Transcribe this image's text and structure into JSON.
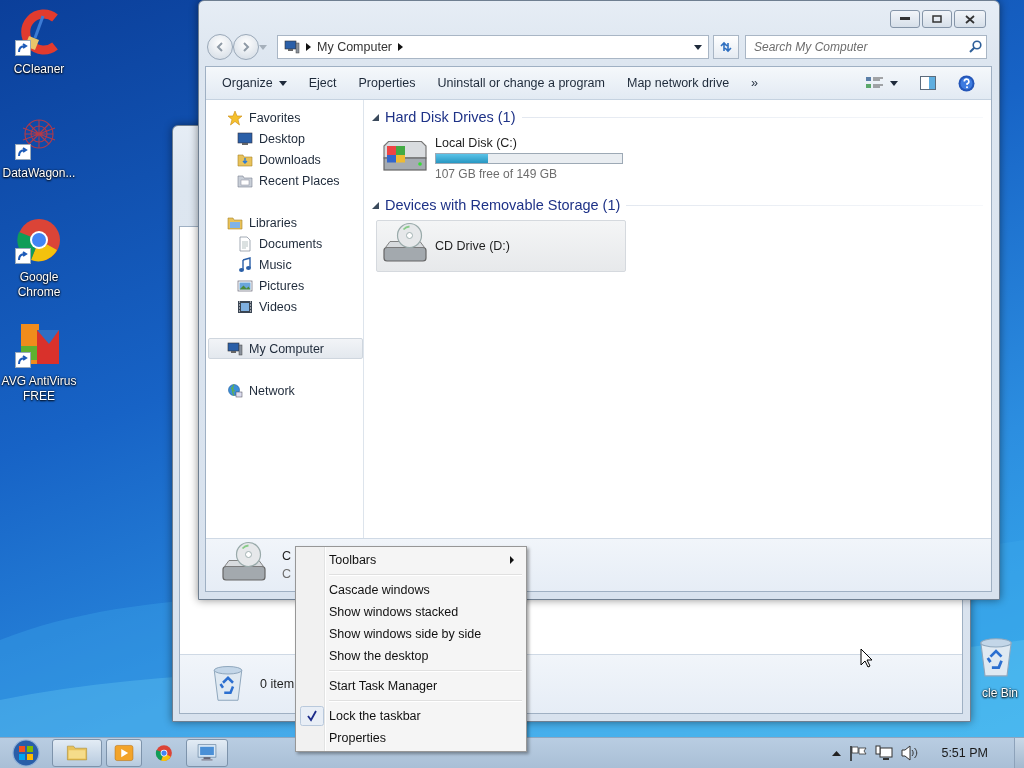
{
  "desktop_icons": [
    {
      "kind": "ccleaner",
      "label": "CCleaner"
    },
    {
      "kind": "datawagon",
      "label": "DataWagon..."
    },
    {
      "kind": "browser",
      "label": "Google Chrome"
    },
    {
      "kind": "antivirus",
      "label": "AVG AntiVirus FREE"
    }
  ],
  "recycle_bin": {
    "label": "cle Bin"
  },
  "back_window": {
    "status": "0 item"
  },
  "explorer": {
    "address": [
      "My Computer"
    ],
    "search": {
      "placeholder": "Search My Computer"
    },
    "commands": [
      {
        "label": "Organize",
        "dropdown": true
      },
      {
        "label": "Eject",
        "dropdown": false
      },
      {
        "label": "Properties",
        "dropdown": false
      },
      {
        "label": "Uninstall or change a program",
        "dropdown": false
      },
      {
        "label": "Map network drive",
        "dropdown": false
      },
      {
        "label": "»",
        "dropdown": false
      }
    ],
    "nav": [
      {
        "kind": "star",
        "label": "Favorites",
        "selected": false,
        "children": [
          {
            "kind": "desktop",
            "label": "Desktop",
            "selected": false
          },
          {
            "kind": "downloads",
            "label": "Downloads",
            "selected": false
          },
          {
            "kind": "recent",
            "label": "Recent Places",
            "selected": false
          }
        ]
      },
      {
        "kind": "library",
        "label": "Libraries",
        "selected": false,
        "children": [
          {
            "kind": "documents",
            "label": "Documents",
            "selected": false
          },
          {
            "kind": "music",
            "label": "Music",
            "selected": false
          },
          {
            "kind": "pictures",
            "label": "Pictures",
            "selected": false
          },
          {
            "kind": "videos",
            "label": "Videos",
            "selected": false
          }
        ]
      },
      {
        "kind": "computer",
        "label": "My Computer",
        "selected": true
      },
      {
        "kind": "network",
        "label": "Network",
        "selected": false
      }
    ],
    "groups": [
      {
        "title": "Hard Disk Drives (1)",
        "expanded": true,
        "drives": [
          {
            "kind": "harddisk",
            "name": "Local Disk (C:)",
            "level": 0.28,
            "free": "107 GB free of 149 GB",
            "selected": false
          }
        ]
      },
      {
        "title": "Devices with Removable Storage (1)",
        "expanded": true,
        "drives": [
          {
            "kind": "cd",
            "name": "CD Drive (D:)",
            "selected": true
          }
        ]
      }
    ],
    "details": {
      "kind": "cd",
      "name": "C",
      "type": "C"
    }
  },
  "context_menu": {
    "items": [
      {
        "kind": "submenu",
        "label": "Toolbars",
        "checked": false
      },
      {
        "kind": "separator"
      },
      {
        "kind": "item",
        "label": "Cascade windows",
        "checked": false
      },
      {
        "kind": "item",
        "label": "Show windows stacked",
        "checked": false
      },
      {
        "kind": "item",
        "label": "Show windows side by side",
        "checked": false
      },
      {
        "kind": "item",
        "label": "Show the desktop",
        "checked": false
      },
      {
        "kind": "separator"
      },
      {
        "kind": "item",
        "label": "Start Task Manager",
        "checked": false
      },
      {
        "kind": "separator"
      },
      {
        "kind": "item",
        "label": "Lock the taskbar",
        "checked": true
      },
      {
        "kind": "item",
        "label": "Properties",
        "checked": false
      }
    ]
  },
  "taskbar": {
    "buttons": [
      {
        "kind": "folder",
        "running": true
      },
      {
        "kind": "media",
        "running": true
      },
      {
        "kind": "browser",
        "running": false
      },
      {
        "kind": "remote",
        "running": true
      }
    ],
    "clock": "5:51 PM"
  }
}
